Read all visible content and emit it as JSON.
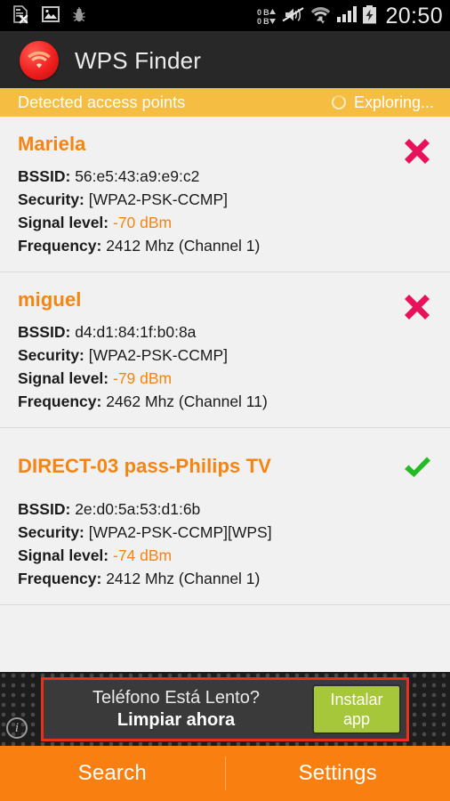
{
  "statusbar": {
    "left_icons": [
      "sim-card-error-icon",
      "image-icon",
      "bug-icon"
    ],
    "traffic_up": "0 B",
    "traffic_down": "0 B",
    "right_icons": [
      "mute-vibrate-icon",
      "wifi-icon",
      "cell-signal-icon",
      "battery-charging-icon"
    ],
    "clock": "20:50"
  },
  "header": {
    "logo": "wifi-logo-icon",
    "title": "WPS Finder"
  },
  "subheader": {
    "title": "Detected access points",
    "spinner": "loading-spinner-icon",
    "status": "Exploring..."
  },
  "labels": {
    "bssid": "BSSID:",
    "security": "Security:",
    "signal": "Signal level:",
    "frequency": "Frequency:"
  },
  "access_points": [
    {
      "ssid": "Mariela",
      "bssid": "56:e5:43:a9:e9:c2",
      "security": "[WPA2-PSK-CCMP]",
      "signal": "-70 dBm",
      "frequency": "2412 Mhz (Channel 1)",
      "status": "unsupported",
      "status_icon": "red-x-icon"
    },
    {
      "ssid": "miguel",
      "bssid": "d4:d1:84:1f:b0:8a",
      "security": "[WPA2-PSK-CCMP]",
      "signal": "-79 dBm",
      "frequency": "2462 Mhz (Channel 11)",
      "status": "unsupported",
      "status_icon": "red-x-icon"
    },
    {
      "ssid": "DIRECT-03 pass-Philips TV",
      "bssid": "2e:d0:5a:53:d1:6b",
      "security": "[WPA2-PSK-CCMP][WPS]",
      "signal": "-74 dBm",
      "frequency": "2412 Mhz (Channel 1)",
      "status": "supported",
      "status_icon": "green-check-icon"
    }
  ],
  "ad": {
    "line1": "Teléfono Está Lento?",
    "line2": "Limpiar ahora",
    "cta_line1": "Instalar",
    "cta_line2": "app",
    "info_icon": "ad-info-icon",
    "info_glyph": "i"
  },
  "bottom_nav": {
    "search": "Search",
    "settings": "Settings"
  },
  "colors": {
    "accent_orange": "#f58410",
    "bottom_bar_orange": "#f98010",
    "amber_subheader": "#f5be42",
    "action_bar": "#282828",
    "status_ok_green": "#22bb22",
    "status_bad_red": "#e8125c",
    "ad_border_red": "#e8301a",
    "ad_cta_green": "#a6c739"
  }
}
